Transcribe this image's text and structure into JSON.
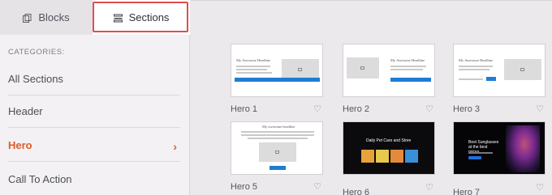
{
  "tabs": {
    "blocks": "Blocks",
    "sections": "Sections"
  },
  "categories": {
    "title": "CATEGORIES:",
    "items": [
      {
        "label": "All Sections"
      },
      {
        "label": "Header"
      },
      {
        "label": "Hero",
        "active": true
      },
      {
        "label": "Call To Action"
      }
    ]
  },
  "cards": [
    {
      "label": "Hero 1",
      "headline": "My Awesome Headline"
    },
    {
      "label": "Hero 2",
      "headline": "My Awesome Headline"
    },
    {
      "label": "Hero 3",
      "headline": "My Awesome Headline"
    },
    {
      "label": "Hero 5",
      "headline": "My awesome headline"
    },
    {
      "label": "Hero 6",
      "headline": "Daily Pet Care and Store"
    },
    {
      "label": "Hero 7",
      "headline": "Best Sunglasses at the best prices"
    }
  ],
  "icons": {
    "blocks": "blocks-icon",
    "sections": "sections-icon",
    "heart": "heart-icon",
    "chevron": "chevron-right-icon"
  },
  "colors": {
    "accent": "#e25a24",
    "highlight": "#e04d4d",
    "button": "#1f7cd4"
  }
}
